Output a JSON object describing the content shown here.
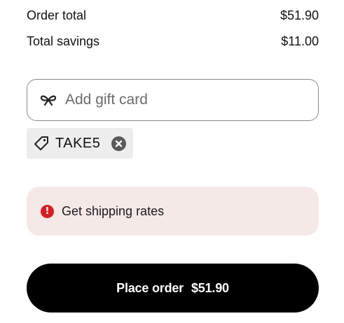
{
  "summary": {
    "order_total_label": "Order total",
    "order_total_value": "$51.90",
    "savings_label": "Total savings",
    "savings_value": "$11.00"
  },
  "gift_card": {
    "placeholder": "Add gift card",
    "value": "",
    "icon": "gift-bow-icon"
  },
  "discount": {
    "code": "TAKE5",
    "icon": "tag-icon",
    "remove_icon": "remove-x-icon"
  },
  "alert": {
    "message": "Get shipping rates",
    "icon": "error-icon",
    "icon_glyph": "!",
    "background": "#f5e9e8",
    "icon_color": "#d51f25"
  },
  "place_order": {
    "label": "Place order",
    "amount": "$51.90",
    "background": "#000000"
  }
}
